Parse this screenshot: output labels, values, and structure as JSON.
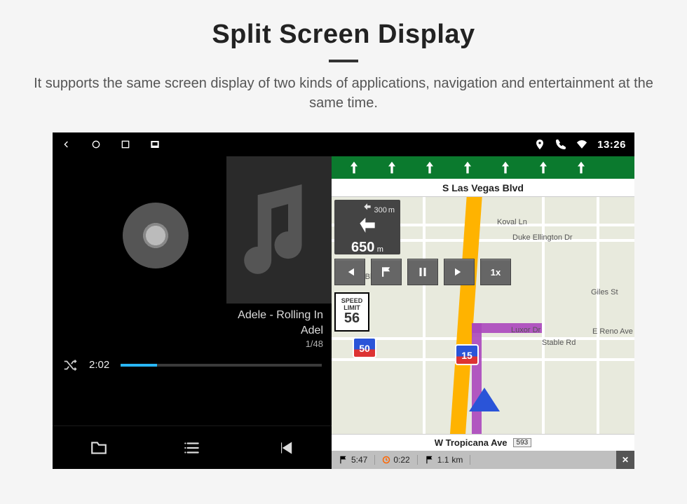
{
  "page": {
    "title": "Split Screen Display",
    "subtitle": "It supports the same screen display of two kinds of applications, navigation and entertainment at the same time."
  },
  "statusbar": {
    "clock": "13:26"
  },
  "music": {
    "track_line1": "Adele - Rolling In",
    "track_line2": "Adel",
    "counter": "1/48",
    "elapsed": "2:02"
  },
  "nav": {
    "top_street": "S Las Vegas Blvd",
    "bottom_street": "W Tropicana Ave",
    "bottom_exit": "593",
    "turn": {
      "primary_dist": "650",
      "primary_unit": "m",
      "secondary_dist": "300",
      "secondary_unit": "m"
    },
    "speed_label1": "SPEED",
    "speed_label2": "LIMIT",
    "speed_value": "56",
    "shield_1": "50",
    "shield_2": "15",
    "speed_multiplier": "1x",
    "eta": "5:47",
    "drive_time": "0:22",
    "remaining_dist": "1.1",
    "remaining_unit": "km",
    "labels": {
      "koval": "Koval Ln",
      "duke": "Duke Ellington Dr",
      "vegas": "Vegas Blvd",
      "luxor": "Luxor Dr",
      "stable": "Stable Rd",
      "reno": "E Reno Ave",
      "giles": "Giles St"
    }
  }
}
